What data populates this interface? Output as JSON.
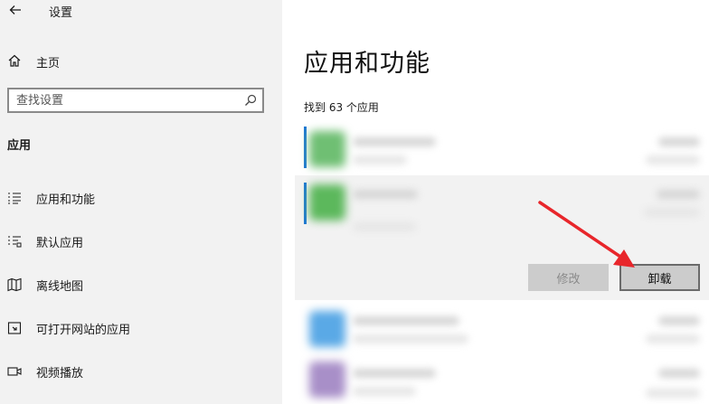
{
  "window": {
    "title": "设置"
  },
  "sidebar": {
    "home_label": "主页",
    "search_placeholder": "查找设置",
    "section_title": "应用",
    "items": [
      {
        "label": "应用和功能",
        "icon": "apps-list-icon"
      },
      {
        "label": "默认应用",
        "icon": "default-apps-icon"
      },
      {
        "label": "离线地图",
        "icon": "map-icon"
      },
      {
        "label": "可打开网站的应用",
        "icon": "open-website-icon"
      },
      {
        "label": "视频播放",
        "icon": "video-icon"
      }
    ]
  },
  "main": {
    "title": "应用和功能",
    "found_text": "找到 63 个应用",
    "buttons": {
      "modify": "修改",
      "uninstall": "卸载"
    },
    "app_icon_colors": [
      "#6fbf73",
      "#5cb85c",
      "#5aa9e6",
      "#a88fc8"
    ]
  },
  "colors": {
    "accent": "#1e78d4",
    "annotation_arrow": "#e8262b"
  }
}
